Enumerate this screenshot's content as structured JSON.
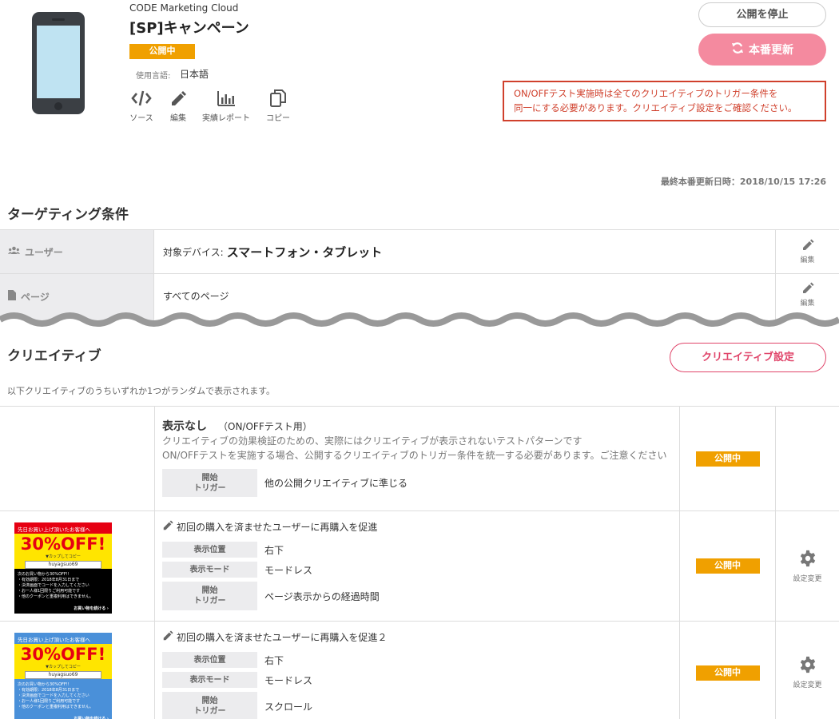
{
  "header": {
    "app_name": "CODE Marketing Cloud",
    "campaign_title": "[SP]キャンペーン",
    "status": "公開中",
    "language_label": "使用言語:",
    "language_value": "日本語",
    "tools": [
      {
        "label": "ソース",
        "icon": "code-icon"
      },
      {
        "label": "編集",
        "icon": "pencil-icon"
      },
      {
        "label": "実績レポート",
        "icon": "bar-chart-icon"
      },
      {
        "label": "コピー",
        "icon": "copy-icon"
      }
    ],
    "stop_button": "公開を停止",
    "publish_button": "本番更新",
    "warning_line1": "ON/OFFテスト実施時は全てのクリエイティブのトリガー条件を",
    "warning_line2": "同一にする必要があります。クリエイティブ設定をご確認ください。",
    "last_updated": "最終本番更新日時：2018/10/15 17:26"
  },
  "targeting": {
    "title": "ターゲティング条件",
    "rows": [
      {
        "label": "ユーザー",
        "icon": "users-icon",
        "prefix": "対象デバイス:",
        "value": "スマートフォン・タブレット",
        "edit": "編集"
      },
      {
        "label": "ページ",
        "icon": "page-icon",
        "prefix": "すべてのページ",
        "value": "",
        "edit": "編集"
      }
    ]
  },
  "creatives": {
    "title": "クリエイティブ",
    "settings_button": "クリエイティブ設定",
    "description": "以下クリエイティブのうちいずれか1つがランダムで表示されます。",
    "items": [
      {
        "title": "表示なし",
        "subtitle": "（ON/OFFテスト用）",
        "note1": "クリエイティブの効果検証のための、実際にはクリエイティブが表示されないテストパターンです",
        "note2": "ON/OFFテストを実施する場合、公開するクリエイティブのトリガー条件を統一する必要があります。ご注意ください",
        "trigger_key": "開始\nトリガー",
        "trigger_value": "他の公開クリエイティブに準じる",
        "status": "公開中"
      },
      {
        "title": "初回の購入を済ませたユーザーに再購入を促進",
        "position_key": "表示位置",
        "position_value": "右下",
        "mode_key": "表示モード",
        "mode_value": "モードレス",
        "trigger_key": "開始\nトリガー",
        "trigger_value": "ページ表示からの経過時間",
        "status": "公開中",
        "action": "設定変更",
        "banner_color": "#e60012"
      },
      {
        "title": "初回の購入を済ませたユーザーに再購入を促進２",
        "position_key": "表示位置",
        "position_value": "右下",
        "mode_key": "表示モード",
        "mode_value": "モードレス",
        "trigger_key": "開始\nトリガー",
        "trigger_value": "スクロール",
        "status": "公開中",
        "action": "設定変更",
        "banner_color": "#4a90d9"
      }
    ],
    "banner": {
      "top": "先日お買い上げ頂いたお客様へ",
      "off": "30%OFF!",
      "copy": "▼カップしてコピー",
      "code": "huyagsuo69",
      "body1": "次のお買い物から30%OFF!!",
      "body2": "・有効期限：2018年8月31日まで",
      "body3": "・決済画面でコードを入力してください",
      "body4": "・お一人様1回限りご利用可能です",
      "body5": "・他のクーポンと重複利用はできません。",
      "foot": "お買い物を続ける ›"
    }
  },
  "colors": {
    "accent_pink": "#e0456a",
    "publish_pink": "#f48a9f",
    "status_orange": "#f0a000",
    "warning_red": "#d0402c"
  }
}
